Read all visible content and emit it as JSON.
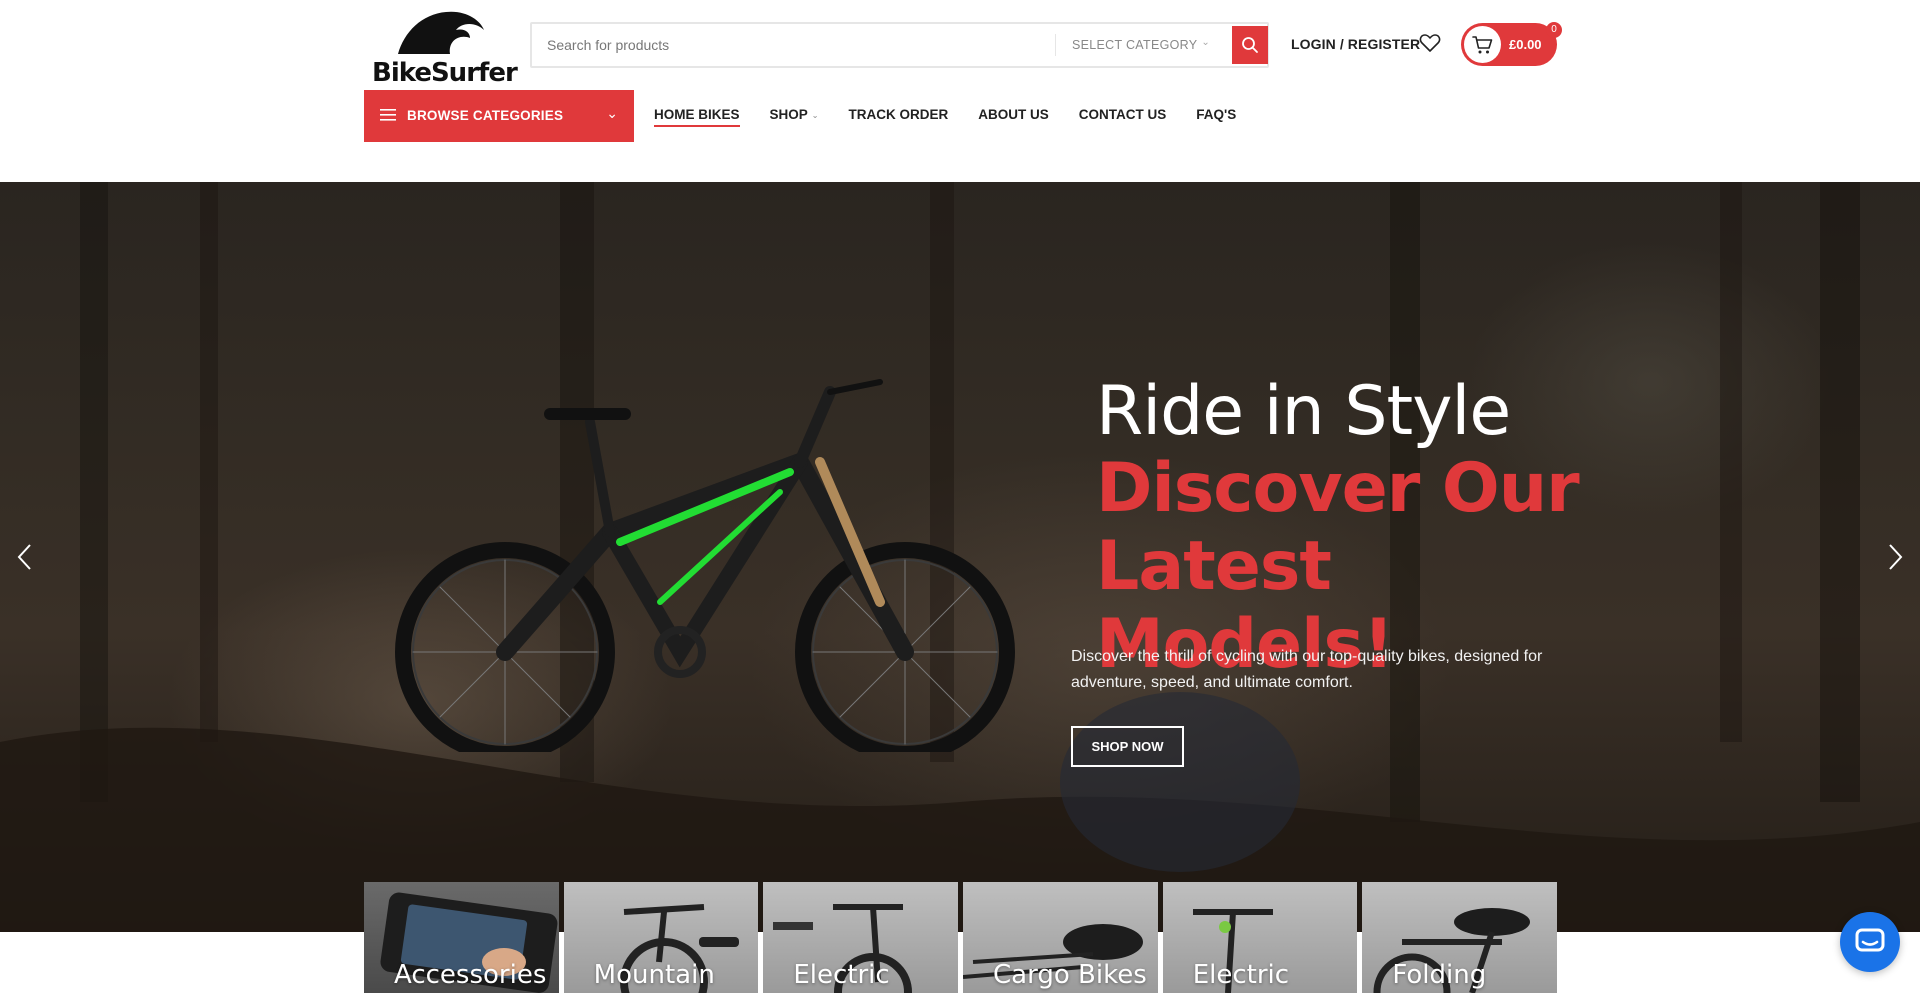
{
  "brand": {
    "name": "BikeSurfer"
  },
  "search": {
    "placeholder": "Search for products",
    "category_label": "SELECT CATEGORY"
  },
  "header_actions": {
    "login_label": "LOGIN / REGISTER",
    "cart_total": "£0.00",
    "cart_count": "0"
  },
  "browse": {
    "label": "BROWSE CATEGORIES"
  },
  "nav": {
    "items": [
      {
        "label": "HOME BIKES",
        "active": true
      },
      {
        "label": "SHOP",
        "has_submenu": true
      },
      {
        "label": "TRACK ORDER"
      },
      {
        "label": "ABOUT US"
      },
      {
        "label": "CONTACT US"
      },
      {
        "label": "FAQ'S"
      }
    ]
  },
  "hero": {
    "title_line1": "Ride in Style",
    "title_line2": "Discover Our Latest Models!",
    "description": "Discover the thrill of cycling with our top-quality bikes, designed for adventure, speed, and ultimate comfort.",
    "cta_label": "SHOP NOW"
  },
  "categories": [
    {
      "label": "Accessories"
    },
    {
      "label": "Mountain"
    },
    {
      "label": "Electric"
    },
    {
      "label": "Cargo Bikes"
    },
    {
      "label": "Electric"
    },
    {
      "label": "Folding"
    }
  ],
  "colors": {
    "accent": "#e0393b",
    "hero_text": "#ffffff",
    "bike_accent": "#22dd33",
    "chat_button": "#1a73e8"
  },
  "icons": {
    "search": "search-icon",
    "wishlist": "heart-icon",
    "cart": "cart-icon",
    "menu": "hamburger-icon",
    "prev": "chevron-left-icon",
    "next": "chevron-right-icon",
    "chat": "chat-icon"
  }
}
